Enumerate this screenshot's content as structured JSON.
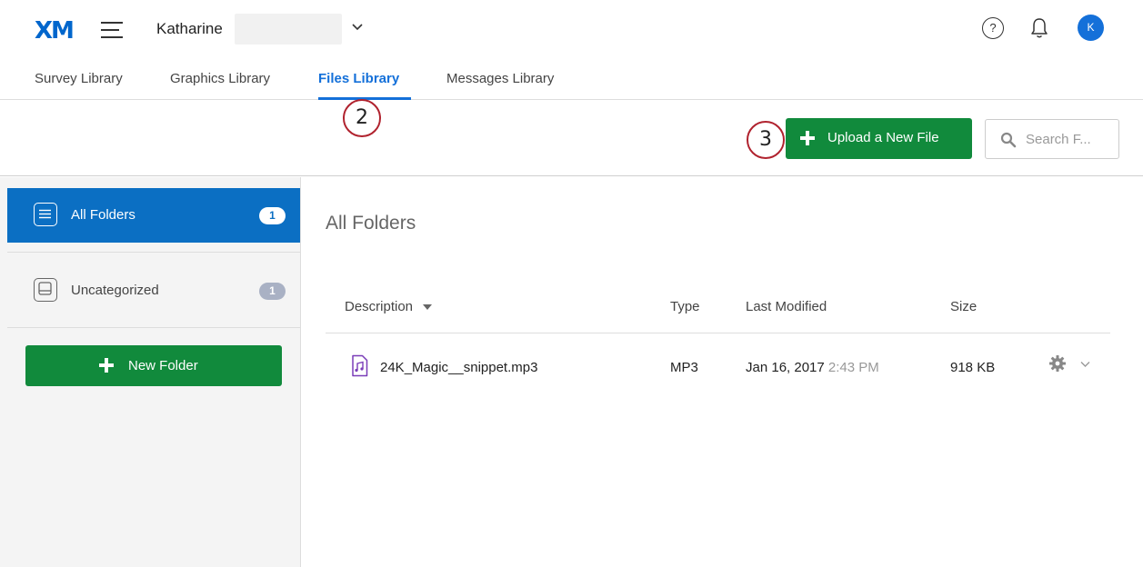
{
  "header": {
    "logo": "XM",
    "brand_name": "Katharine",
    "avatar_initial": "K",
    "help_symbol": "?"
  },
  "tabs": [
    {
      "label": "Survey Library",
      "active": false
    },
    {
      "label": "Graphics Library",
      "active": false
    },
    {
      "label": "Files Library",
      "active": true
    },
    {
      "label": "Messages Library",
      "active": false
    }
  ],
  "annotations": {
    "tab_step": "2",
    "upload_step": "3"
  },
  "toolbar": {
    "upload_label": "Upload a New File",
    "search_placeholder": "Search F..."
  },
  "sidebar": {
    "items": [
      {
        "label": "All Folders",
        "count": "1",
        "active": true,
        "icon": "list-icon"
      },
      {
        "label": "Uncategorized",
        "count": "1",
        "active": false,
        "icon": "inbox-tray-icon"
      }
    ],
    "new_folder_label": "New Folder"
  },
  "main": {
    "title": "All Folders",
    "columns": {
      "description": "Description",
      "type": "Type",
      "last_modified": "Last Modified",
      "size": "Size"
    },
    "rows": [
      {
        "name": "24K_Magic__snippet.mp3",
        "type": "MP3",
        "date": "Jan 16, 2017",
        "time": "2:43 PM",
        "size": "918 KB",
        "icon": "audio-file-icon"
      }
    ]
  },
  "colors": {
    "accent_blue": "#1470d9",
    "sidebar_active": "#0b6fc3",
    "button_green": "#118a3c",
    "annotation_red": "#b0222e",
    "file_icon_purple": "#7a3db8"
  }
}
